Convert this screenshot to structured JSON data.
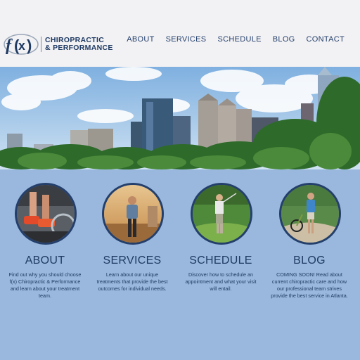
{
  "brand": {
    "logo_mark": "fx",
    "name_line1": "CHIROPRACTIC",
    "name_line2": "& PERFORMANCE"
  },
  "nav": {
    "items": [
      "ABOUT",
      "SERVICES",
      "SCHEDULE",
      "BLOG",
      "CONTACT"
    ]
  },
  "colors": {
    "header_bg": "#f2f2f4",
    "content_bg": "#9ab8dd",
    "brand_navy": "#1f3a63"
  },
  "features": [
    {
      "title": "ABOUT",
      "body": "Find out why you should choose f(x) Chiropractic & Performance and learn about your treatment team.",
      "image_icon": "athlete-shoes-photo"
    },
    {
      "title": "SERVICES",
      "body": "Learn about our unique treatments that provide the best outcomes for individual needs.",
      "image_icon": "man-outdoors-photo"
    },
    {
      "title": "SCHEDULE",
      "body": "Discover how to schedule an appointment and what your visit will entail.",
      "image_icon": "golfer-photo"
    },
    {
      "title": "BLOG",
      "body": "COMING SOON! Read about current chiropractic care and how our professional team strives provide the best service in Atlanta.",
      "image_icon": "cyclist-photo"
    }
  ]
}
